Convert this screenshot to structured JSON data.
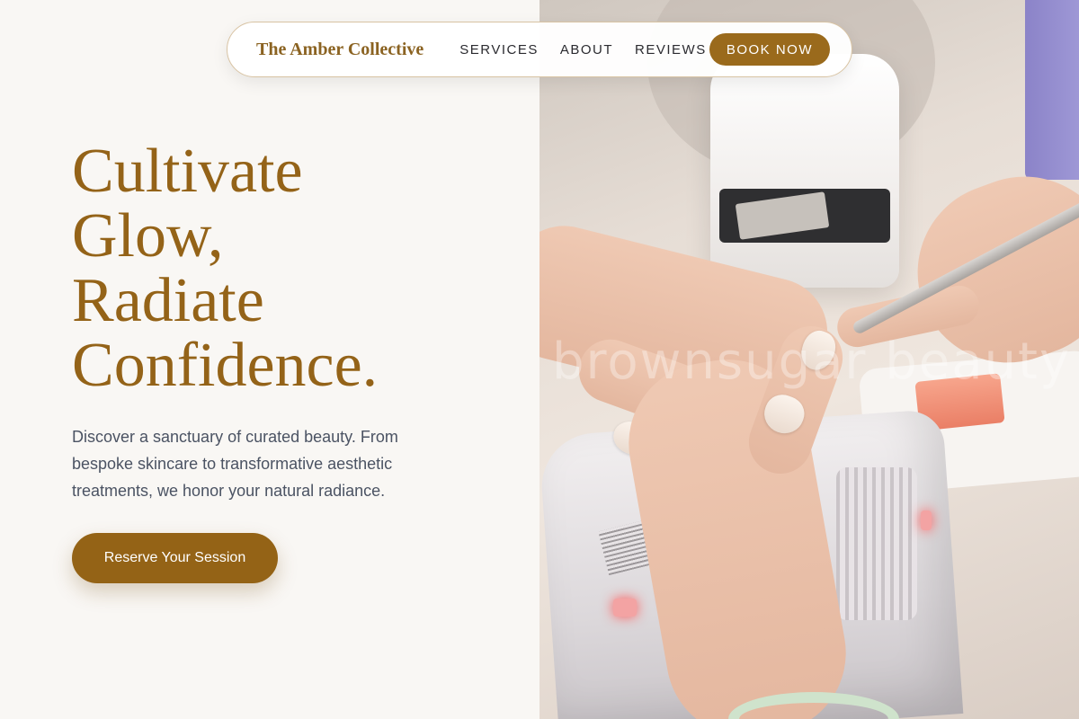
{
  "brand": {
    "name": "The Amber Collective"
  },
  "nav": {
    "links": [
      "SERVICES",
      "ABOUT",
      "REVIEWS"
    ],
    "cta_label": "BOOK NOW"
  },
  "hero": {
    "headline_lines": [
      "Cultivate",
      "Glow,",
      "Radiate",
      "Confidence."
    ],
    "subtitle": "Discover a sanctuary of curated beauty. From bespoke skincare to transformative aesthetic treatments, we honor your natural radiance.",
    "cta_label": "Reserve Your Session",
    "image_watermark": "brownsugar beauty"
  },
  "colors": {
    "accent": "#946318",
    "page_background": "#f9f7f4",
    "body_text": "#4b5363",
    "nav_text": "#2b2b30"
  }
}
